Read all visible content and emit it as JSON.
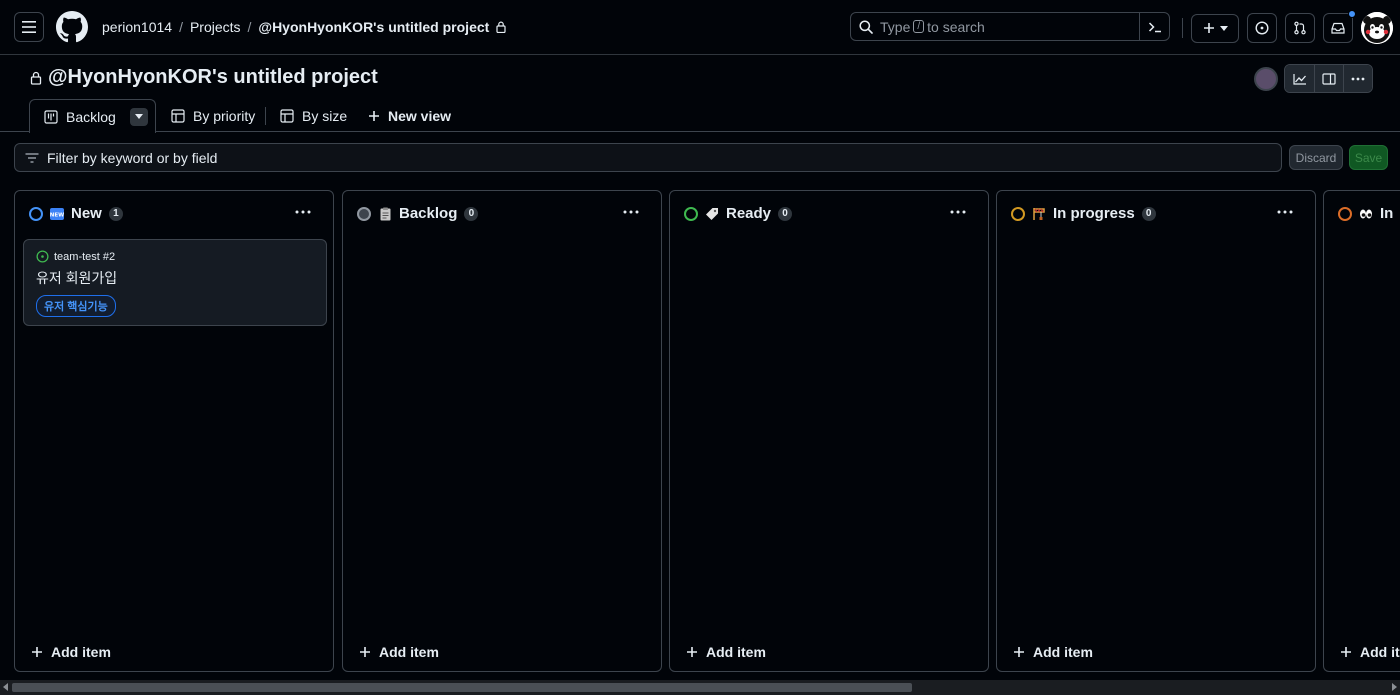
{
  "header": {
    "breadcrumb": [
      "perion1014",
      "Projects",
      "@HyonHyonKOR's untitled project"
    ],
    "search_placeholder_before": "Type",
    "search_key": "/",
    "search_placeholder_after": "to search"
  },
  "project": {
    "title": "@HyonHyonKOR's untitled project"
  },
  "views": {
    "tabs": [
      "Backlog",
      "By priority",
      "By size"
    ],
    "new_view": "New view"
  },
  "filter": {
    "placeholder": "Filter by keyword or by field",
    "discard": "Discard",
    "save": "Save"
  },
  "columns": [
    {
      "name": "New",
      "count": "1",
      "status_color": "#4493f8",
      "emoji": "new",
      "add_label": "Add item"
    },
    {
      "name": "Backlog",
      "count": "0",
      "status_color": "#9198a1",
      "emoji": "clipboard",
      "add_label": "Add item"
    },
    {
      "name": "Ready",
      "count": "0",
      "status_color": "#3fb950",
      "emoji": "label-tag",
      "add_label": "Add item"
    },
    {
      "name": "In progress",
      "count": "0",
      "status_color": "#d29922",
      "emoji": "construction",
      "add_label": "Add item"
    },
    {
      "name": "In",
      "count": "",
      "status_color": "#db6d28",
      "emoji": "eyes",
      "add_label": "Add ite"
    }
  ],
  "card": {
    "repo": "team-test #2",
    "title": "유저 회원가입",
    "label": "유저 핵심기능"
  }
}
